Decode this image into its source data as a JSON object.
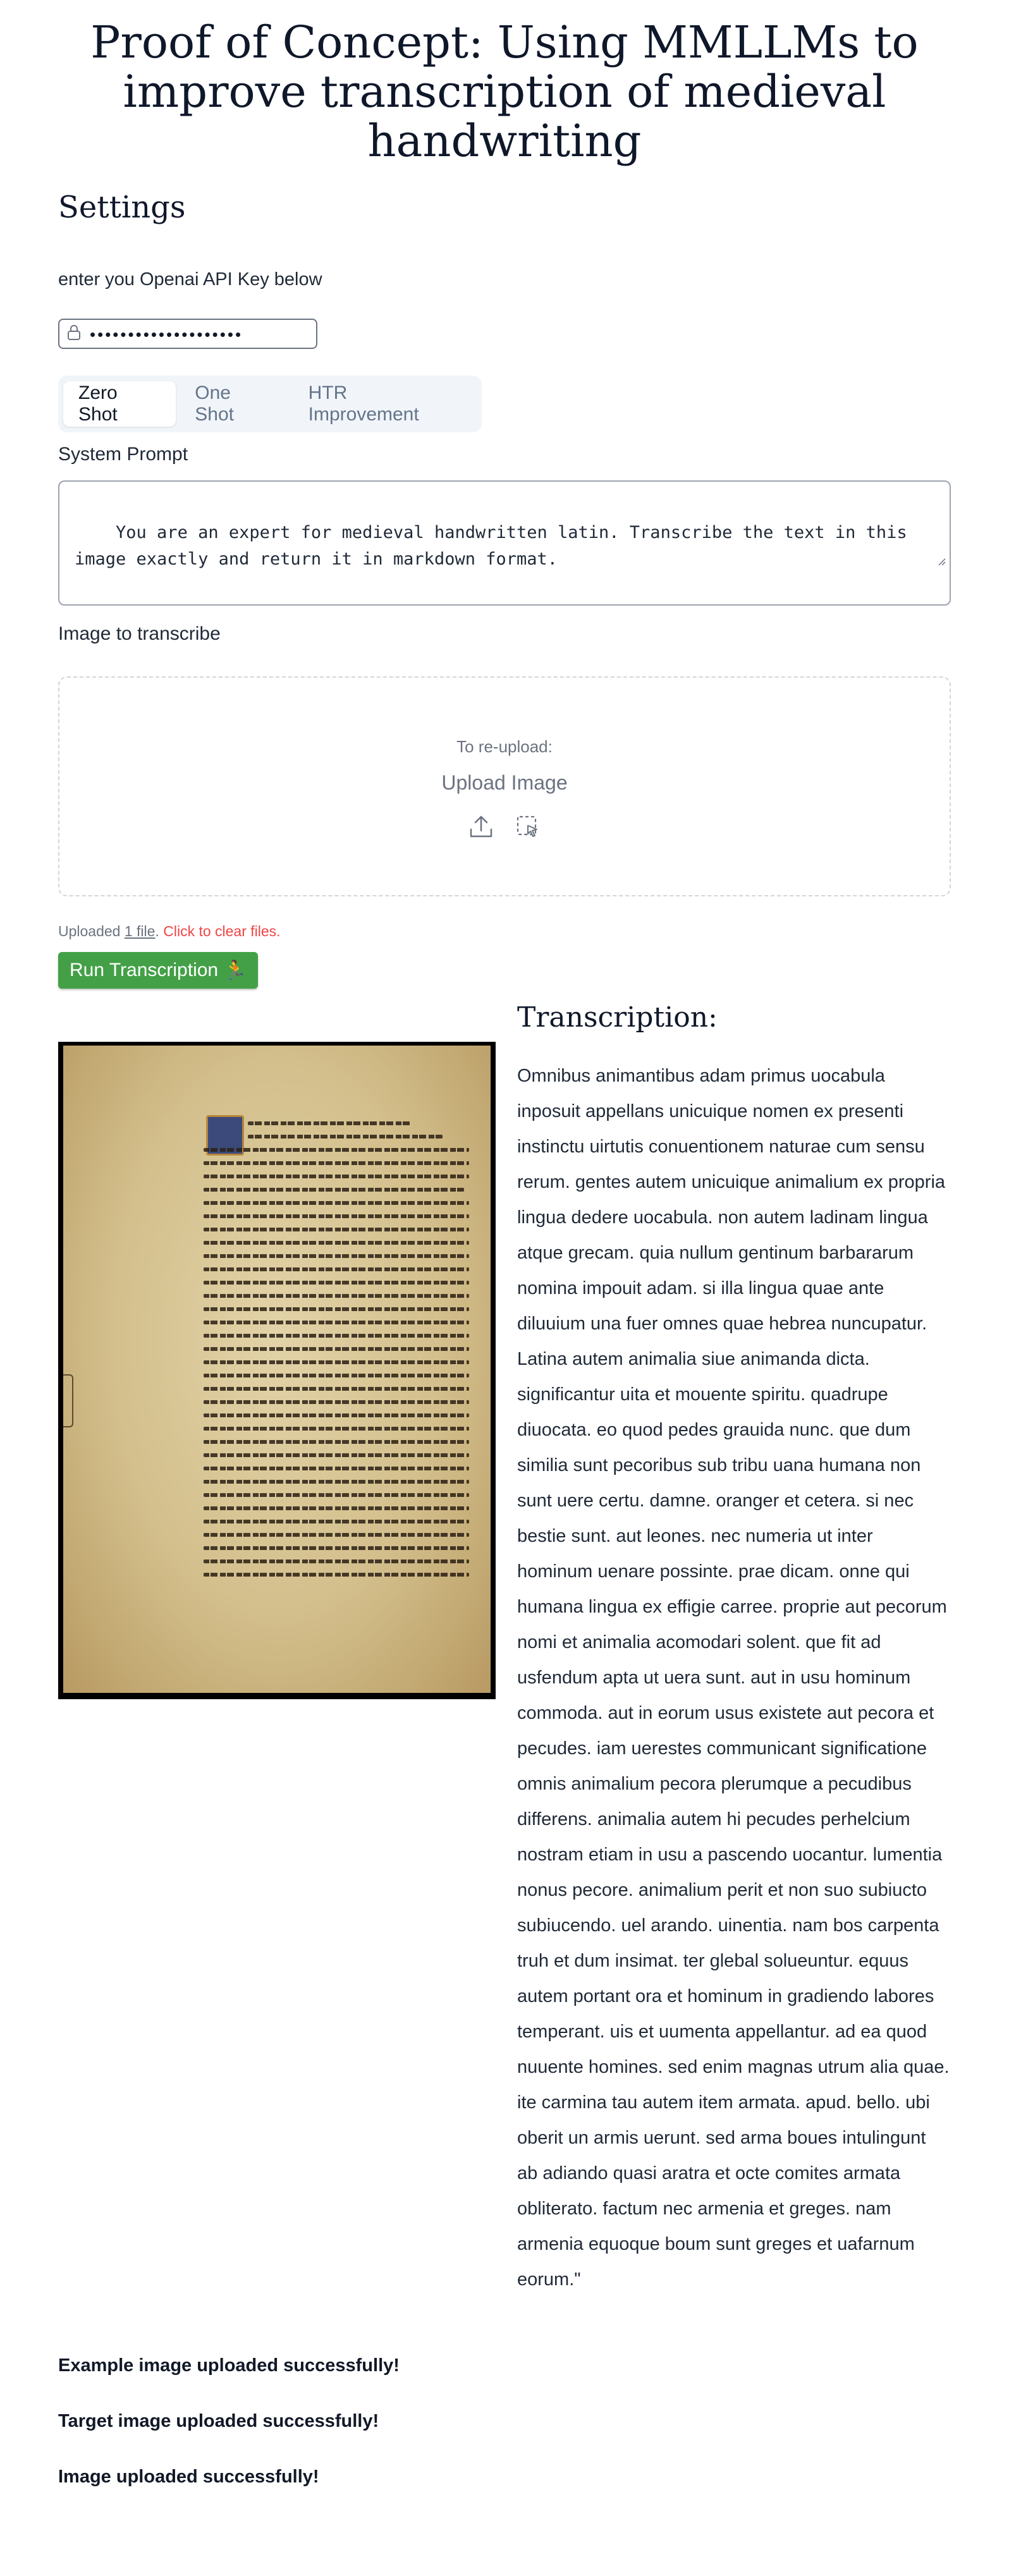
{
  "title": "Proof of Concept: Using MMLLMs to improve transcription of medieval handwriting",
  "settings": {
    "heading": "Settings",
    "api_key_label": "enter you Openai API Key below",
    "api_key_value": "••••••••••••••••••••"
  },
  "tabs": [
    {
      "label": "Zero Shot",
      "active": true
    },
    {
      "label": "One Shot",
      "active": false
    },
    {
      "label": "HTR Improvement",
      "active": false
    }
  ],
  "system_prompt": {
    "label": "System Prompt",
    "value": "You are an expert for medieval handwritten latin. Transcribe the text in this\nimage exactly and return it in markdown format."
  },
  "image_upload": {
    "label": "Image to transcribe",
    "reupload_hint": "To re-upload:",
    "upload_label": "Upload Image",
    "uploaded_prefix": "Uploaded ",
    "uploaded_count": "1 file",
    "uploaded_sep": ".",
    "clear_text": " Click to clear files."
  },
  "run_button": {
    "label": "Run Transcription",
    "icon": "🏃"
  },
  "transcription": {
    "heading": "Transcription:",
    "text": "Omnibus animantibus adam primus uocabula inposuit appellans unicuique nomen ex presenti instinctu uirtutis conuentionem naturae cum sensu rerum. gentes autem unicuique animalium ex propria lingua dedere uocabula. non autem ladinam lingua atque grecam. quia nullum gentinum barbararum nomina impouit adam. si illa lingua quae ante diluuium una fuer omnes quae hebrea nuncupatur. Latina autem animalia siue animanda dicta. significantur uita et mouente spiritu. quadrupe diuocata. eo quod pedes grauida nunc. que dum similia sunt pecoribus sub tribu uana humana non sunt uere certu. damne. oranger et cetera. si nec bestie sunt. aut leones. nec numeria ut inter hominum uenare possinte. prae dicam. onne qui humana lingua ex effigie carree. proprie aut pecorum nomi et animalia acomodari solent. que fit ad usfendum apta ut uera sunt. aut in usu hominum commoda. aut in eorum usus existete aut pecora et pecudes. iam uerestes communicant significatione omnis animalium pecora plerumque a pecudibus differens. animalia autem hi pecudes perhelcium nostram etiam in usu a pascendo uocantur. lumentia nonus pecore. animalium perit et non suo subiucto subiucendo. uel arando. uinentia. nam bos carpenta truh et dum insimat. ter glebal solueuntur. equus autem portant ora et hominum in gradiendo labores temperant. uis et uumenta appellantur. ad ea quod nuuente homines. sed enim magnas utrum alia quae. ite carmina tau autem item armata. apud. bello. ubi oberit un armis uerunt. sed arma boues intulingunt ab adiando quasi aratra et octe comites armata obliterato. factum nec armenia et greges. nam armenia equoque boum sunt greges et uafarnum eorum.\""
  },
  "status_messages": [
    "Example image uploaded successfully!",
    "Target image uploaded successfully!",
    "Image uploaded successfully!"
  ],
  "colors": {
    "run_button": "#43a047",
    "clear_files": "#ef4444",
    "tab_bg": "#f1f5f9"
  }
}
